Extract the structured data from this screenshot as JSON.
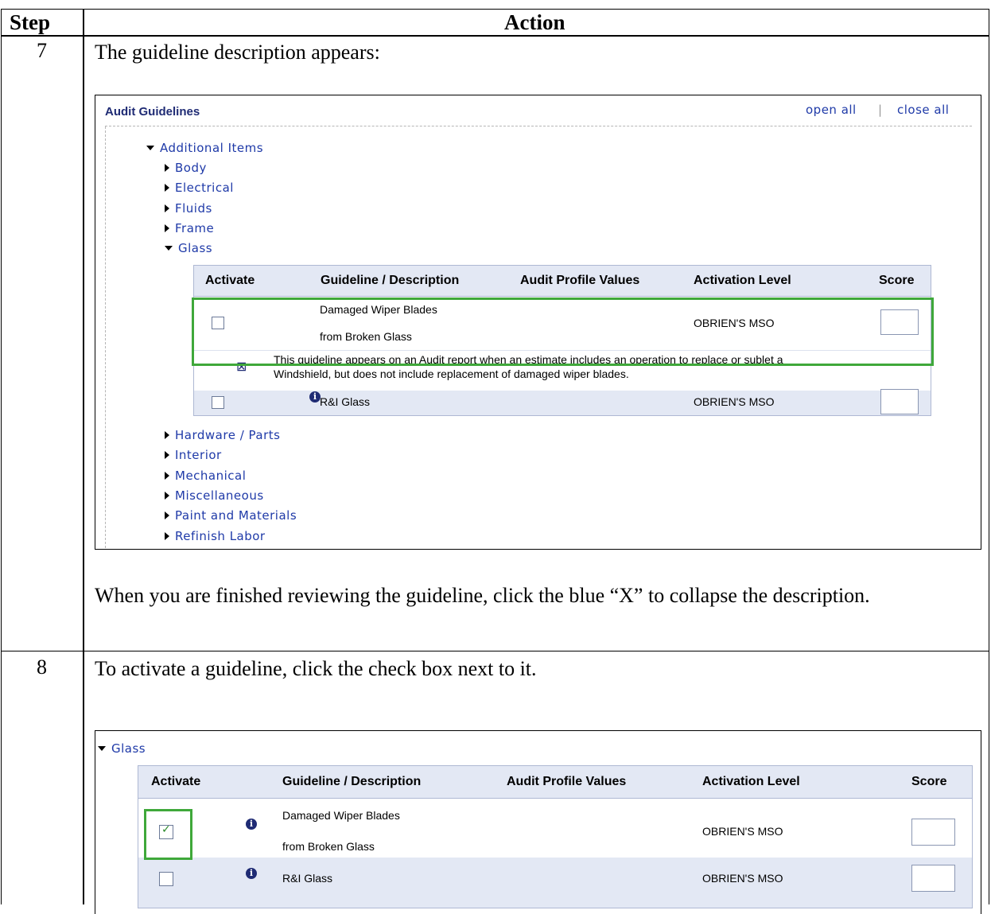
{
  "table": {
    "header_step": "Step",
    "header_action": "Action"
  },
  "step7": {
    "number": "7",
    "intro": "The guideline description appears:",
    "after": "When you are finished reviewing the guideline, click the blue “X” to collapse the description.",
    "screenshot": {
      "title": "Audit Guidelines",
      "open_all": "open all",
      "separator": "|",
      "close_all": "close all",
      "tree": {
        "root": "Additional Items",
        "items": [
          "Body",
          "Electrical",
          "Fluids",
          "Frame",
          "Glass",
          "Hardware / Parts",
          "Interior",
          "Mechanical",
          "Miscellaneous",
          "Paint and Materials",
          "Refinish Labor"
        ]
      },
      "columns": [
        "Activate",
        "Guideline / Description",
        "Audit Profile Values",
        "Activation Level",
        "Score"
      ],
      "rows": [
        {
          "guideline_line1": "Damaged Wiper Blades",
          "guideline_line2": "from Broken Glass",
          "activation_level": "OBRIEN'S MSO",
          "checked": false
        },
        {
          "guideline_line1": "R&I Glass",
          "guideline_line2": "",
          "activation_level": "OBRIEN'S MSO",
          "checked": false
        }
      ],
      "description": "This guideline appears on an Audit report when an estimate includes an operation to replace or sublet a",
      "description2": "Windshield, but does not include replacement of damaged wiper blades."
    }
  },
  "step8": {
    "number": "8",
    "intro": "To activate a guideline, click the check box next to it.",
    "screenshot": {
      "group": "Glass",
      "columns": [
        "Activate",
        "Guideline / Description",
        "Audit Profile Values",
        "Activation Level",
        "Score"
      ],
      "rows": [
        {
          "guideline_line1": "Damaged Wiper Blades",
          "guideline_line2": "from Broken Glass",
          "activation_level": "OBRIEN'S MSO",
          "checked": true
        },
        {
          "guideline_line1": "R&I Glass",
          "guideline_line2": "",
          "activation_level": "OBRIEN'S MSO",
          "checked": false
        }
      ]
    }
  },
  "colors": {
    "link": "#1f3aa8",
    "highlight": "#3fa83a",
    "table_bg": "#e3e8f4"
  }
}
